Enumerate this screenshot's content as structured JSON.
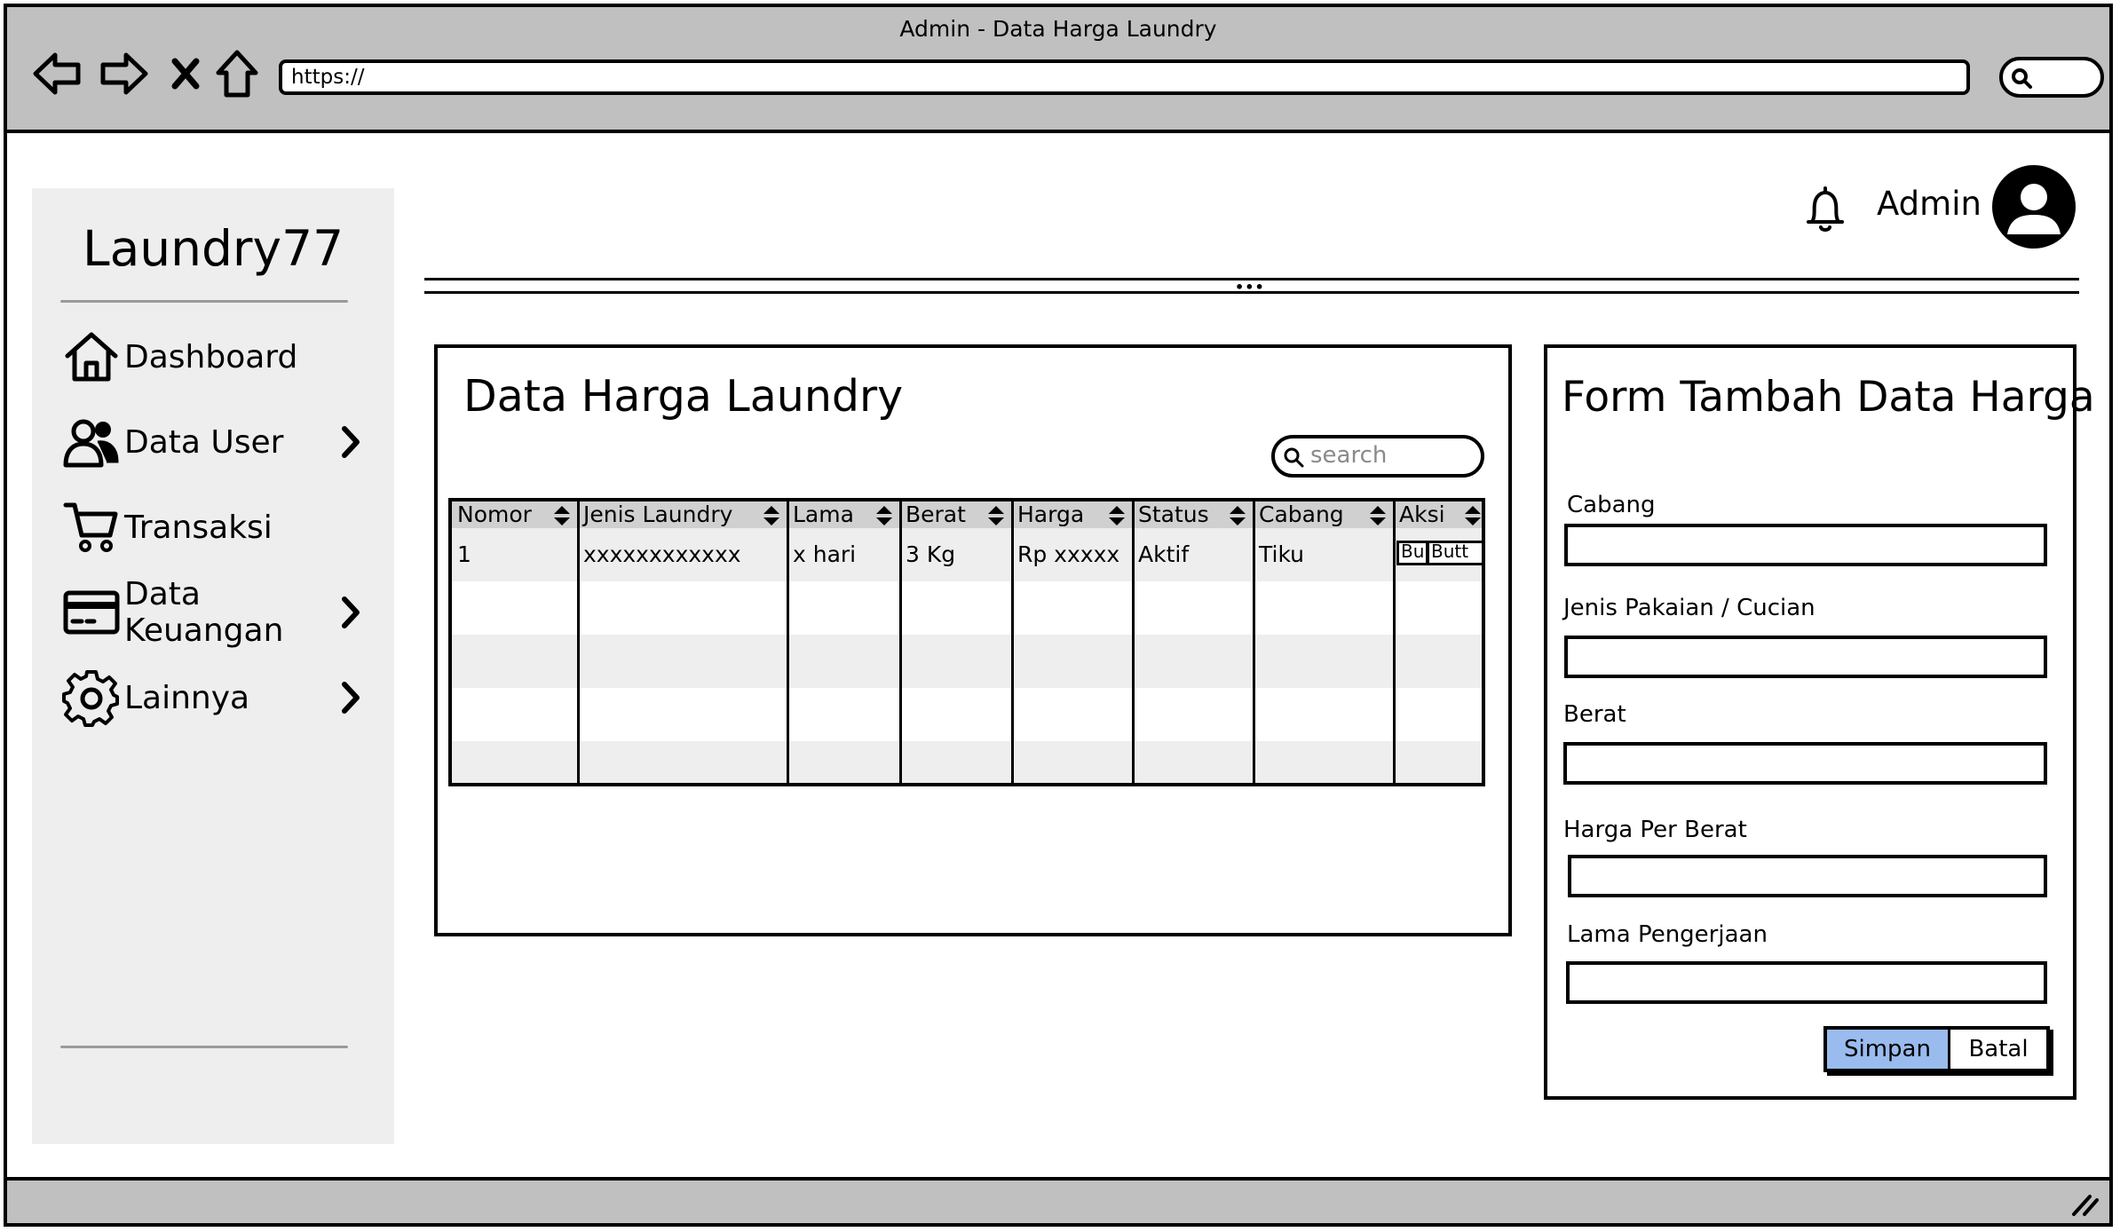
{
  "window": {
    "title": "Admin - Data Harga Laundry"
  },
  "browser": {
    "url": "https://"
  },
  "sidebar": {
    "brand": "Laundry77",
    "items": [
      {
        "label": "Dashboard",
        "icon": "home-icon",
        "has_submenu": false
      },
      {
        "label": "Data User",
        "icon": "users-icon",
        "has_submenu": true
      },
      {
        "label": "Transaksi",
        "icon": "cart-icon",
        "has_submenu": false
      },
      {
        "label": "Data Keuangan",
        "icon": "credit-card-icon",
        "has_submenu": true
      },
      {
        "label": "Lainnya",
        "icon": "gear-icon",
        "has_submenu": true
      }
    ]
  },
  "header": {
    "user_name": "Admin"
  },
  "table_panel": {
    "title": "Data Harga Laundry",
    "search_placeholder": "search",
    "columns": [
      "Nomor",
      "Jenis Laundry",
      "Lama",
      "Berat",
      "Harga",
      "Status",
      "Cabang",
      "Aksi"
    ],
    "rows": [
      {
        "cells": [
          "1",
          "xxxxxxxxxxxx",
          "x hari",
          "3 Kg",
          "Rp xxxxx",
          "Aktif",
          "Tiku"
        ],
        "actions": [
          "Bu",
          "Butt"
        ]
      }
    ]
  },
  "form": {
    "title": "Form Tambah Data Harga",
    "fields": [
      {
        "label": "Cabang",
        "value": ""
      },
      {
        "label": "Jenis Pakaian / Cucian",
        "value": ""
      },
      {
        "label": "Berat",
        "value": ""
      },
      {
        "label": "Harga Per Berat",
        "value": ""
      },
      {
        "label": "Lama Pengerjaan",
        "value": ""
      }
    ],
    "save_label": "Simpan",
    "cancel_label": "Batal"
  },
  "colors": {
    "chrome": "#c0c0c0",
    "sidebar": "#eeeeee",
    "primary_button": "#99bbee",
    "row_stripe": "#eeeeee",
    "header_row": "#d0d0d0"
  }
}
